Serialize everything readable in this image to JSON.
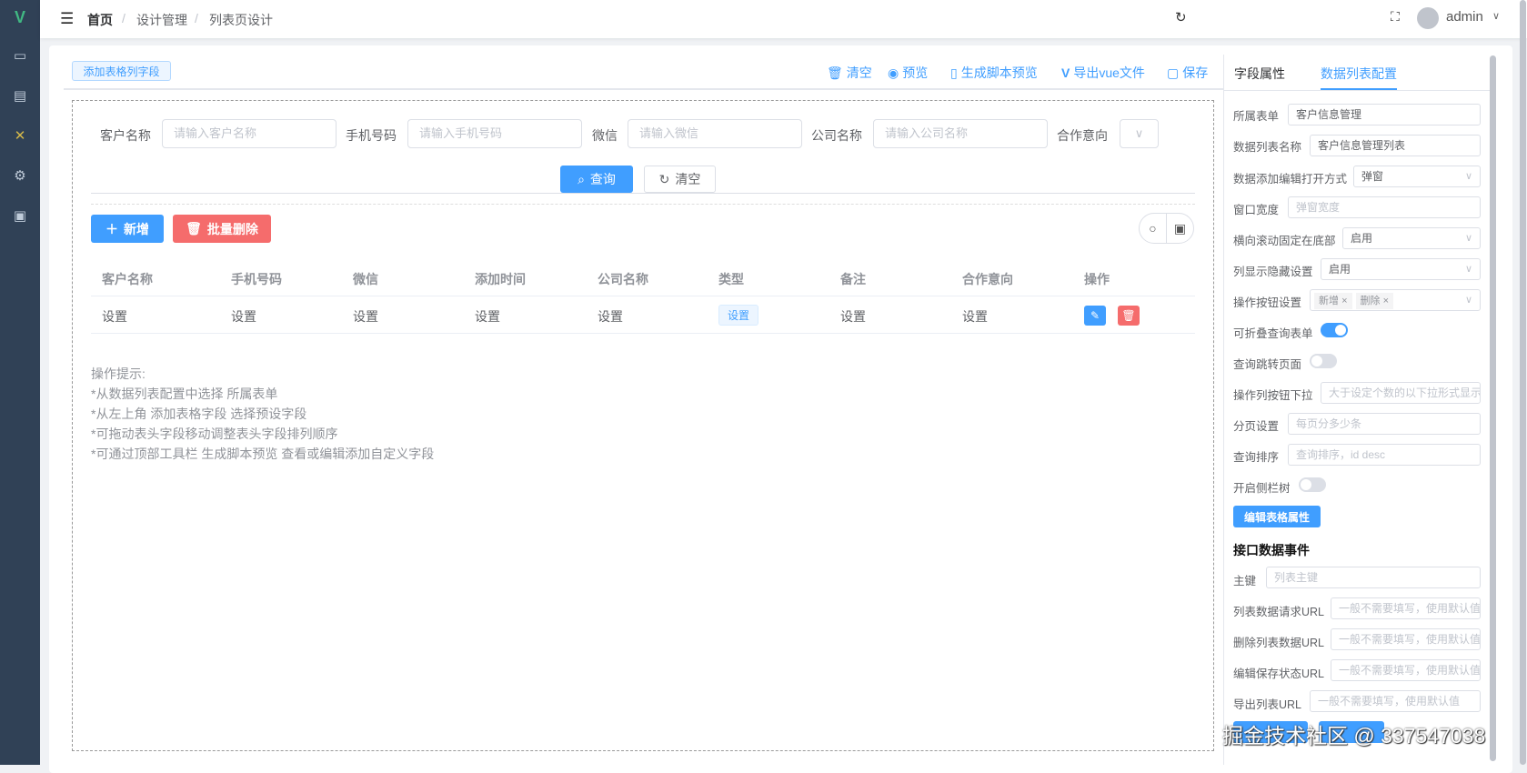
{
  "header": {
    "breadcrumb": [
      "首页",
      "设计管理",
      "列表页设计"
    ],
    "user": "admin"
  },
  "toolbar": {
    "add_field": "添加表格列字段",
    "clear": "清空",
    "preview": "预览",
    "script_preview": "生成脚本预览",
    "export_vue": "导出vue文件",
    "save": "保存"
  },
  "search": {
    "fields": [
      {
        "label": "客户名称",
        "placeholder": "请输入客户名称"
      },
      {
        "label": "手机号码",
        "placeholder": "请输入手机号码"
      },
      {
        "label": "微信",
        "placeholder": "请输入微信"
      },
      {
        "label": "公司名称",
        "placeholder": "请输入公司名称"
      },
      {
        "label": "合作意向",
        "placeholder": ""
      }
    ],
    "query": "查询",
    "reset": "清空"
  },
  "actions": {
    "add": "新增",
    "batch_delete": "批量删除"
  },
  "table": {
    "columns": [
      "客户名称",
      "手机号码",
      "微信",
      "添加时间",
      "公司名称",
      "类型",
      "备注",
      "合作意向",
      "操作"
    ],
    "row": [
      "设置",
      "设置",
      "设置",
      "设置",
      "设置",
      "设置",
      "设置",
      "设置"
    ]
  },
  "tips": [
    "操作提示:",
    "*从数据列表配置中选择 所属表单",
    "*从左上角 添加表格字段 选择预设字段",
    "*可拖动表头字段移动调整表头字段排列顺序",
    "*可通过顶部工具栏 生成脚本预览 查看或编辑添加自定义字段"
  ],
  "panel": {
    "tabs": [
      "字段属性",
      "数据列表配置"
    ],
    "form_label": "所属表单",
    "form_value": "客户信息管理",
    "list_name_label": "数据列表名称",
    "list_name_value": "客户信息管理列表",
    "open_mode_label": "数据添加编辑打开方式",
    "open_mode_value": "弹窗",
    "window_width_label": "窗口宽度",
    "window_width_ph": "弹窗宽度",
    "hscroll_label": "横向滚动固定在底部",
    "hscroll_value": "启用",
    "col_toggle_label": "列显示隐藏设置",
    "col_toggle_value": "启用",
    "op_buttons_label": "操作按钮设置",
    "op_buttons_tags": [
      "新增",
      "删除"
    ],
    "collapsible_label": "可折叠查询表单",
    "collapsible_on": true,
    "jump_label": "查询跳转页面",
    "jump_on": false,
    "dropdown_label": "操作列按钮下拉",
    "dropdown_ph": "大于设定个数的以下拉形式显示",
    "page_label": "分页设置",
    "page_ph": "每页分多少条",
    "sort_label": "查询排序",
    "sort_ph": "查询排序，id desc",
    "tree_label": "开启侧栏树",
    "tree_on": false,
    "edit_table_btn": "编辑表格属性",
    "api_heading": "接口数据事件",
    "pk_label": "主键",
    "pk_ph": "列表主键",
    "list_url_label": "列表数据请求URL",
    "delete_url_label": "删除列表数据URL",
    "save_url_label": "编辑保存状态URL",
    "export_url_label": "导出列表URL",
    "url_ph": "一般不需要填写，使用默认值"
  },
  "watermark": "掘金技术社区 @ 337547038"
}
